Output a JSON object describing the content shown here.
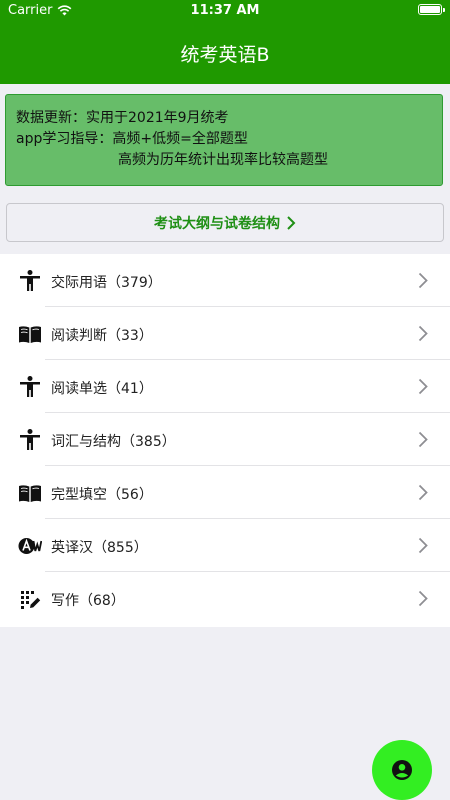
{
  "status_bar": {
    "carrier": "Carrier",
    "time": "11:37 AM"
  },
  "header": {
    "title": "统考英语B"
  },
  "info": {
    "line1": "数据更新：实用于2021年9月统考",
    "line2": "app学习指导：高频+低频=全部题型",
    "line3": "高频为历年统计出现率比较高题型"
  },
  "syllabus_button": {
    "label": "考试大纲与试卷结构"
  },
  "list": {
    "items": [
      {
        "label": "交际用语（379）",
        "icon": "person-icon"
      },
      {
        "label": "阅读判断（33）",
        "icon": "book-icon"
      },
      {
        "label": "阅读单选（41）",
        "icon": "person-icon"
      },
      {
        "label": "词汇与结构（385）",
        "icon": "person-icon"
      },
      {
        "label": "完型填空（56）",
        "icon": "book-icon"
      },
      {
        "label": "英译汉（855）",
        "icon": "translate-icon"
      },
      {
        "label": "写作（68）",
        "icon": "write-icon"
      }
    ]
  },
  "colors": {
    "header": "#1f9900",
    "accent": "#1f8f15",
    "info_bg": "#67bd69",
    "fab": "#33ee22"
  }
}
